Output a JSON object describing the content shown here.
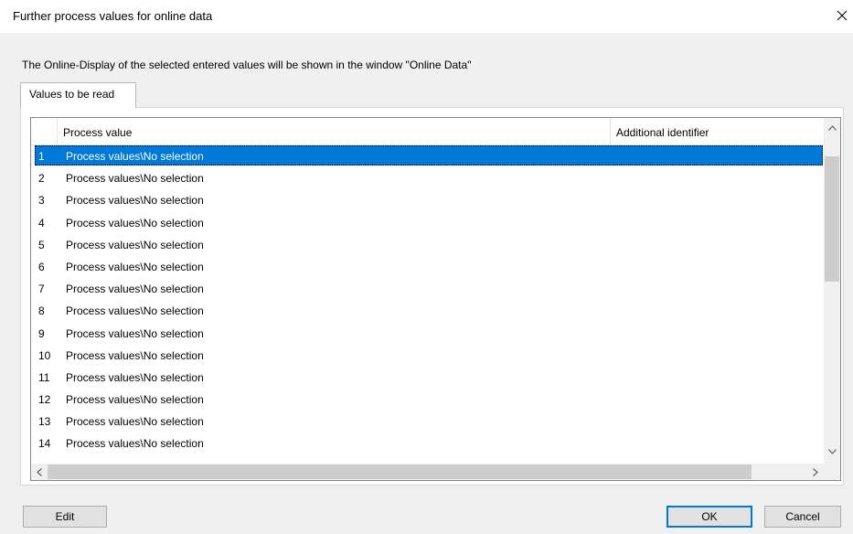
{
  "window": {
    "title": "Further process values for online data",
    "close_icon": "close-icon"
  },
  "info_text": "The Online-Display of the selected entered values will be shown in the window \"Online Data\"",
  "tabs": [
    {
      "label": "Values to be read",
      "active": true
    }
  ],
  "grid": {
    "columns": [
      "",
      "Process value",
      "Additional identifier"
    ],
    "selected_row": 1,
    "rows": [
      {
        "num": "1",
        "value": "Process values\\No selection",
        "identifier": ""
      },
      {
        "num": "2",
        "value": "Process values\\No selection",
        "identifier": ""
      },
      {
        "num": "3",
        "value": "Process values\\No selection",
        "identifier": ""
      },
      {
        "num": "4",
        "value": "Process values\\No selection",
        "identifier": ""
      },
      {
        "num": "5",
        "value": "Process values\\No selection",
        "identifier": ""
      },
      {
        "num": "6",
        "value": "Process values\\No selection",
        "identifier": ""
      },
      {
        "num": "7",
        "value": "Process values\\No selection",
        "identifier": ""
      },
      {
        "num": "8",
        "value": "Process values\\No selection",
        "identifier": ""
      },
      {
        "num": "9",
        "value": "Process values\\No selection",
        "identifier": ""
      },
      {
        "num": "10",
        "value": "Process values\\No selection",
        "identifier": ""
      },
      {
        "num": "11",
        "value": "Process values\\No selection",
        "identifier": ""
      },
      {
        "num": "12",
        "value": "Process values\\No selection",
        "identifier": ""
      },
      {
        "num": "13",
        "value": "Process values\\No selection",
        "identifier": ""
      },
      {
        "num": "14",
        "value": "Process values\\No selection",
        "identifier": ""
      }
    ]
  },
  "buttons": {
    "edit": "Edit",
    "ok": "OK",
    "cancel": "Cancel"
  },
  "colors": {
    "selection": "#0078d7",
    "dialog_bg": "#f0f0f0"
  }
}
